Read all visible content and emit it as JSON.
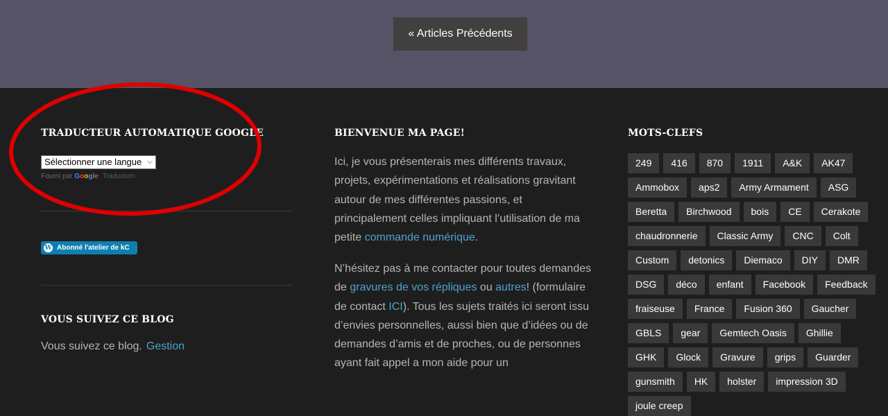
{
  "pagination": {
    "prev_label": "« Articles Précédents"
  },
  "translator": {
    "title": "TRADUCTEUR AUTOMATIQUE GOOGLE",
    "select_value": "Sélectionner une langue",
    "powered_by": "Fourni par",
    "google": "Google",
    "translation": "Traduction"
  },
  "follow_button": {
    "label": "Abonné l'atelier de kC"
  },
  "follow_blog": {
    "title": "VOUS SUIVEZ CE BLOG",
    "text": "Vous suivez ce blog.",
    "manage_link": "Gestion"
  },
  "welcome": {
    "title": "BIENVENUE MA PAGE!",
    "p1_text": "Ici, je vous présenterais mes différents travaux, projets, expérimentations et réalisations gravitant autour de mes différentes passions, et principalement celles impliquant l’utilisation de ma petite ",
    "p1_link": "commande numérique",
    "p1_end": ".",
    "p2_a": "N’hésitez pas à me contacter pour toutes demandes de ",
    "p2_link1": "gravures de vos répliques",
    "p2_b": " ou ",
    "p2_link2": "autres",
    "p2_c": "! (formulaire de contact ",
    "p2_link3": "ICI",
    "p2_d": "). Tous les sujets traités ici seront issu d’envies personnelles, aussi bien que d’idées ou de demandes d’amis et de proches, ou de personnes ayant fait appel a mon aide pour un"
  },
  "tags": {
    "title": "MOTS-CLEFS",
    "items": [
      "249",
      "416",
      "870",
      "1911",
      "A&K",
      "AK47",
      "Ammobox",
      "aps2",
      "Army Armament",
      "ASG",
      "Beretta",
      "Birchwood",
      "bois",
      "CE",
      "Cerakote",
      "chaudronnerie",
      "Classic Army",
      "CNC",
      "Colt",
      "Custom",
      "detonics",
      "Diemaco",
      "DIY",
      "DMR",
      "DSG",
      "déco",
      "enfant",
      "Facebook",
      "Feedback",
      "fraiseuse",
      "France",
      "Fusion 360",
      "Gaucher",
      "GBLS",
      "gear",
      "Gemtech Oasis",
      "Ghillie",
      "GHK",
      "Glock",
      "Gravure",
      "grips",
      "Guarder",
      "gunsmith",
      "HK",
      "holster",
      "impression 3D",
      "joule creep"
    ]
  },
  "colors": {
    "top_band": "#555365",
    "footer_bg": "#1f1e1e",
    "tag_bg": "#3a3838",
    "link": "#4aa4cf",
    "annotation": "#e00000"
  }
}
